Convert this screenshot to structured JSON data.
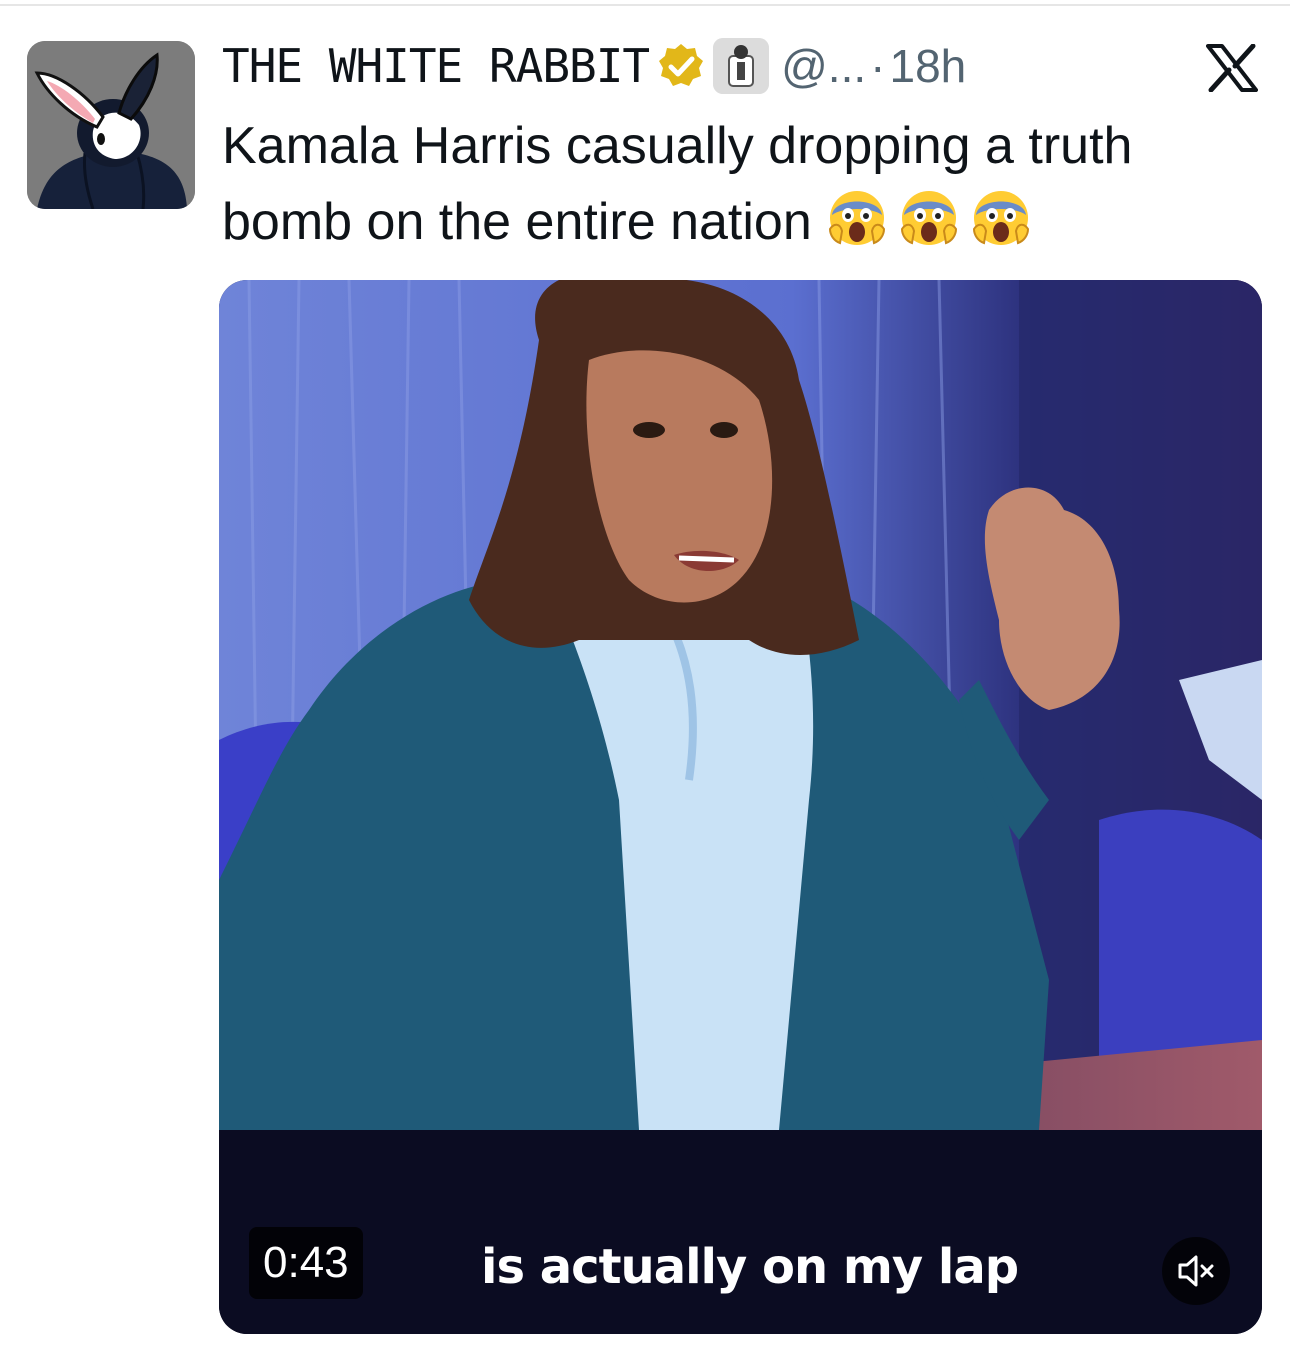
{
  "tweet": {
    "author": {
      "display_name": "THE WHITE RABBIT",
      "handle": "@...",
      "avatar_icon": "rabbit-hoodie-avatar",
      "verified_icon": "gold-verified-badge-icon",
      "affiliation_icon": "affiliation-badge-icon"
    },
    "separator": "·",
    "time": "18h",
    "platform_icon": "x-logo-icon",
    "text": "Kamala Harris casually dropping a truth\nbomb on the entire nation",
    "emojis": [
      "😱",
      "😱",
      "😱"
    ],
    "media": {
      "type": "video",
      "timestamp": "0:43",
      "subtitle": "is actually on my lap",
      "mute_icon": "speaker-muted-icon"
    }
  },
  "colors": {
    "text_primary": "#0f1419",
    "text_secondary": "#536471",
    "verified_gold": "#e2b719",
    "video_bg": "#0b0c22"
  }
}
